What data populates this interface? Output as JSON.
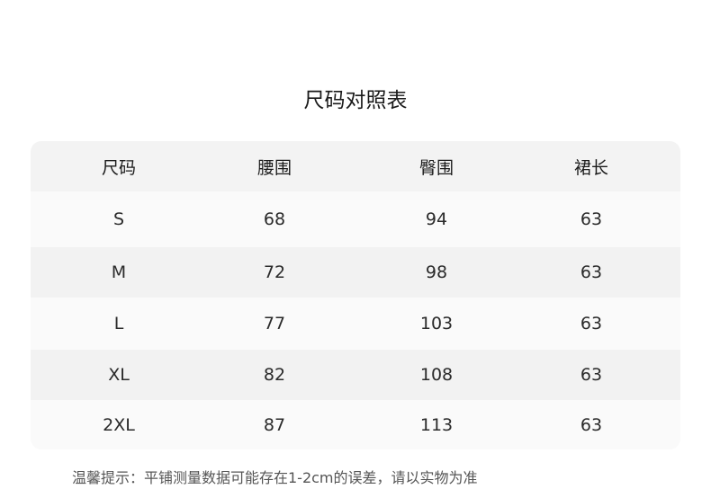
{
  "title": "尺码对照表",
  "table": {
    "headers": [
      "尺码",
      "腰围",
      "臀围",
      "裙长"
    ],
    "rows": [
      [
        "S",
        "68",
        "94",
        "63"
      ],
      [
        "M",
        "72",
        "98",
        "63"
      ],
      [
        "L",
        "77",
        "103",
        "63"
      ],
      [
        "XL",
        "82",
        "108",
        "63"
      ],
      [
        "2XL",
        "87",
        "113",
        "63"
      ]
    ]
  },
  "note": "温馨提示：平铺测量数据可能存在1-2cm的误差，请以实物为准",
  "colors": {
    "header_bg": "#f3f3f3",
    "row_light": "#fafafa",
    "row_dark": "#f2f2f2",
    "text": "#2a2a2a",
    "note_text": "#555555"
  }
}
